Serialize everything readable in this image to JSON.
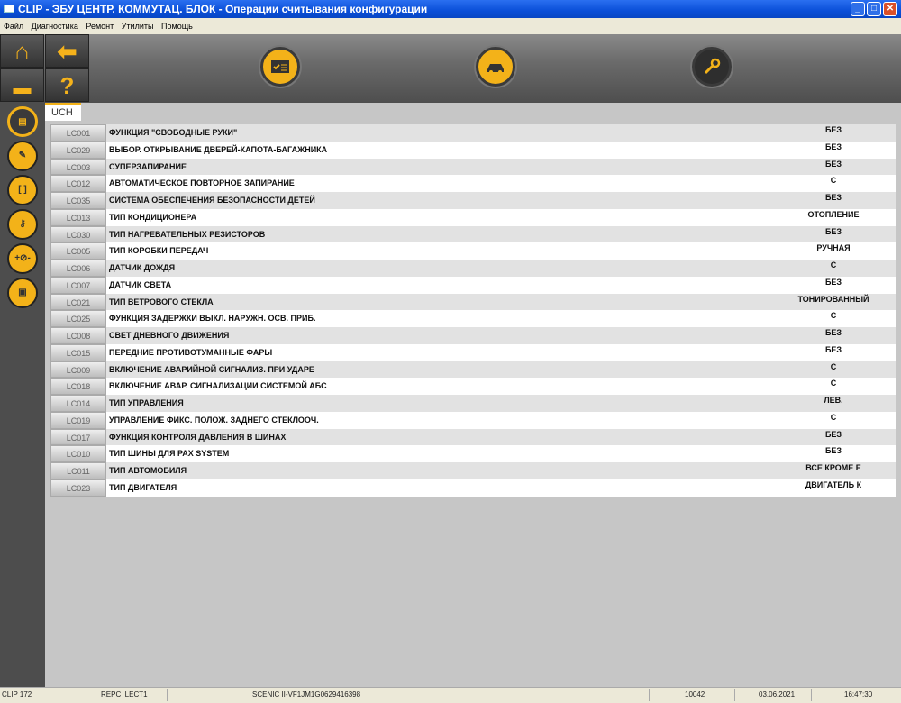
{
  "window": {
    "title": "CLIP - ЭБУ ЦЕНТР. КОММУТАЦ. БЛОК - Операции считывания конфигурации"
  },
  "menu": [
    "Файл",
    "Диагностика",
    "Ремонт",
    "Утилиты",
    "Помощь"
  ],
  "tab": "UCH",
  "rows": [
    {
      "code": "LC001",
      "label": "ФУНКЦИЯ \"СВОБОДНЫЕ РУКИ\"",
      "value": "БЕЗ"
    },
    {
      "code": "LC029",
      "label": "ВЫБОР. ОТКРЫВАНИЕ ДВЕРЕЙ-КАПОТА-БАГАЖНИКА",
      "value": "БЕЗ"
    },
    {
      "code": "LC003",
      "label": "СУПЕРЗАПИРАНИЕ",
      "value": "БЕЗ"
    },
    {
      "code": "LC012",
      "label": "АВТОМАТИЧЕСКОЕ ПОВТОРНОЕ ЗАПИРАНИЕ",
      "value": "С"
    },
    {
      "code": "LC035",
      "label": "СИСТЕМА ОБЕСПЕЧЕНИЯ БЕЗОПАСНОСТИ ДЕТЕЙ",
      "value": "БЕЗ"
    },
    {
      "code": "LC013",
      "label": "ТИП КОНДИЦИОНЕРА",
      "value": "ОТОПЛЕНИЕ"
    },
    {
      "code": "LC030",
      "label": "ТИП НАГРЕВАТЕЛЬНЫХ РЕЗИСТОРОВ",
      "value": "БЕЗ"
    },
    {
      "code": "LC005",
      "label": "ТИП КОРОБКИ ПЕРЕДАЧ",
      "value": "РУЧНАЯ"
    },
    {
      "code": "LC006",
      "label": "ДАТЧИК ДОЖДЯ",
      "value": "С"
    },
    {
      "code": "LC007",
      "label": "ДАТЧИК СВЕТА",
      "value": "БЕЗ"
    },
    {
      "code": "LC021",
      "label": "ТИП ВЕТРОВОГО СТЕКЛА",
      "value": "ТОНИРОВАННЫЙ"
    },
    {
      "code": "LC025",
      "label": "ФУНКЦИЯ ЗАДЕРЖКИ ВЫКЛ. НАРУЖН. ОСВ. ПРИБ.",
      "value": "С"
    },
    {
      "code": "LC008",
      "label": "СВЕТ ДНЕВНОГО ДВИЖЕНИЯ",
      "value": "БЕЗ"
    },
    {
      "code": "LC015",
      "label": "ПЕРЕДНИЕ ПРОТИВОТУМАННЫЕ ФАРЫ",
      "value": "БЕЗ"
    },
    {
      "code": "LC009",
      "label": "ВКЛЮЧЕНИЕ АВАРИЙНОЙ СИГНАЛИЗ. ПРИ УДАРЕ",
      "value": "С"
    },
    {
      "code": "LC018",
      "label": "ВКЛЮЧЕНИЕ АВАР. СИГНАЛИЗАЦИИ СИСТЕМОЙ АБС",
      "value": "С"
    },
    {
      "code": "LC014",
      "label": "ТИП УПРАВЛЕНИЯ",
      "value": "ЛЕВ."
    },
    {
      "code": "LC019",
      "label": "УПРАВЛЕНИЕ ФИКС. ПОЛОЖ. ЗАДНЕГО СТЕКЛООЧ.",
      "value": "С"
    },
    {
      "code": "LC017",
      "label": "ФУНКЦИЯ КОНТРОЛЯ ДАВЛЕНИЯ В ШИНАХ",
      "value": "БЕЗ"
    },
    {
      "code": "LC010",
      "label": "ТИП ШИНЫ ДЛЯ PAX SYSTEM",
      "value": "БЕЗ"
    },
    {
      "code": "LC011",
      "label": "ТИП АВТОМОБИЛЯ",
      "value": "ВСЕ КРОМЕ Е"
    },
    {
      "code": "LC023",
      "label": "ТИП ДВИГАТЕЛЯ",
      "value": "ДВИГАТЕЛЬ К"
    }
  ],
  "status": {
    "version": "CLIP 172",
    "operation": "REPC_LECT1",
    "vehicle": "SCENIC II-VF1JM1G0629416398",
    "code": "10042",
    "date": "03.06.2021",
    "time": "16:47:30"
  },
  "colors": {
    "accent": "#f3b219",
    "titlebar": "#0a4fd8"
  }
}
